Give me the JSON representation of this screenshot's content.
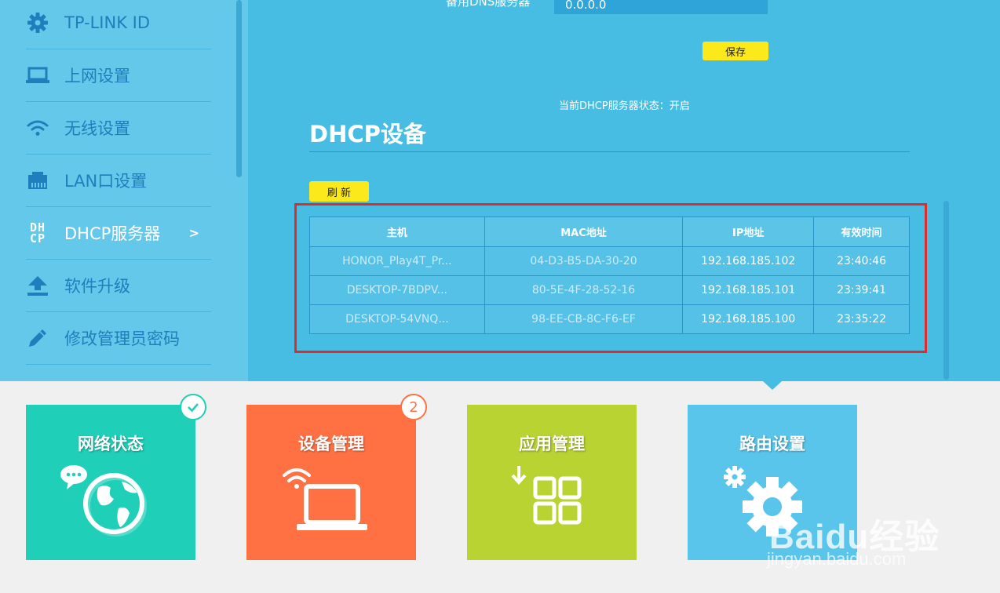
{
  "sidebar": {
    "items": [
      {
        "label": "TP-LINK ID",
        "icon": "gear-icon"
      },
      {
        "label": "上网设置",
        "icon": "laptop-icon"
      },
      {
        "label": "无线设置",
        "icon": "wifi-icon"
      },
      {
        "label": "LAN口设置",
        "icon": "lan-port-icon"
      },
      {
        "label": "DHCP服务器",
        "icon": "dhcp-icon",
        "icon_text": "DH\nCP",
        "chevron": ">",
        "active": true
      },
      {
        "label": "软件升级",
        "icon": "upload-icon"
      },
      {
        "label": "修改管理员密码",
        "icon": "pencil-icon"
      }
    ]
  },
  "dns": {
    "label": "备用DNS服务器",
    "value": "0.0.0.0"
  },
  "save_button": "保存",
  "server_status": "当前DHCP服务器状态：开启",
  "section_title": "DHCP设备",
  "refresh_button": "刷 新",
  "table": {
    "headers": [
      "主机",
      "MAC地址",
      "IP地址",
      "有效时间"
    ],
    "rows": [
      {
        "host": "HONOR_Play4T_Pr...",
        "mac": "04-D3-B5-DA-30-20",
        "ip": "192.168.185.102",
        "time": "23:40:46"
      },
      {
        "host": "DESKTOP-7BDPV...",
        "mac": "80-5E-4F-28-52-16",
        "ip": "192.168.185.101",
        "time": "23:39:41"
      },
      {
        "host": "DESKTOP-54VNQ...",
        "mac": "98-EE-CB-8C-F6-EF",
        "ip": "192.168.185.100",
        "time": "23:35:22"
      }
    ]
  },
  "tiles": [
    {
      "title": "网络状态",
      "color": "#1fcfb8",
      "icon": "globe-chat-icon",
      "badge_icon": "check-icon"
    },
    {
      "title": "设备管理",
      "color": "#ff7143",
      "icon": "laptop-wifi-icon",
      "badge": "2"
    },
    {
      "title": "应用管理",
      "color": "#b8d332",
      "icon": "app-grid-icon"
    },
    {
      "title": "路由设置",
      "color": "#5ac5ea",
      "icon": "gears-icon"
    }
  ],
  "watermark": {
    "brand": "Baidu经验",
    "url": "jingyan.baidu.com"
  },
  "colors": {
    "sidebar_bg": "#64c8ea",
    "panel_bg": "#48bde3",
    "accent_yellow": "#fce91b",
    "highlight_red": "#e02b2b"
  }
}
